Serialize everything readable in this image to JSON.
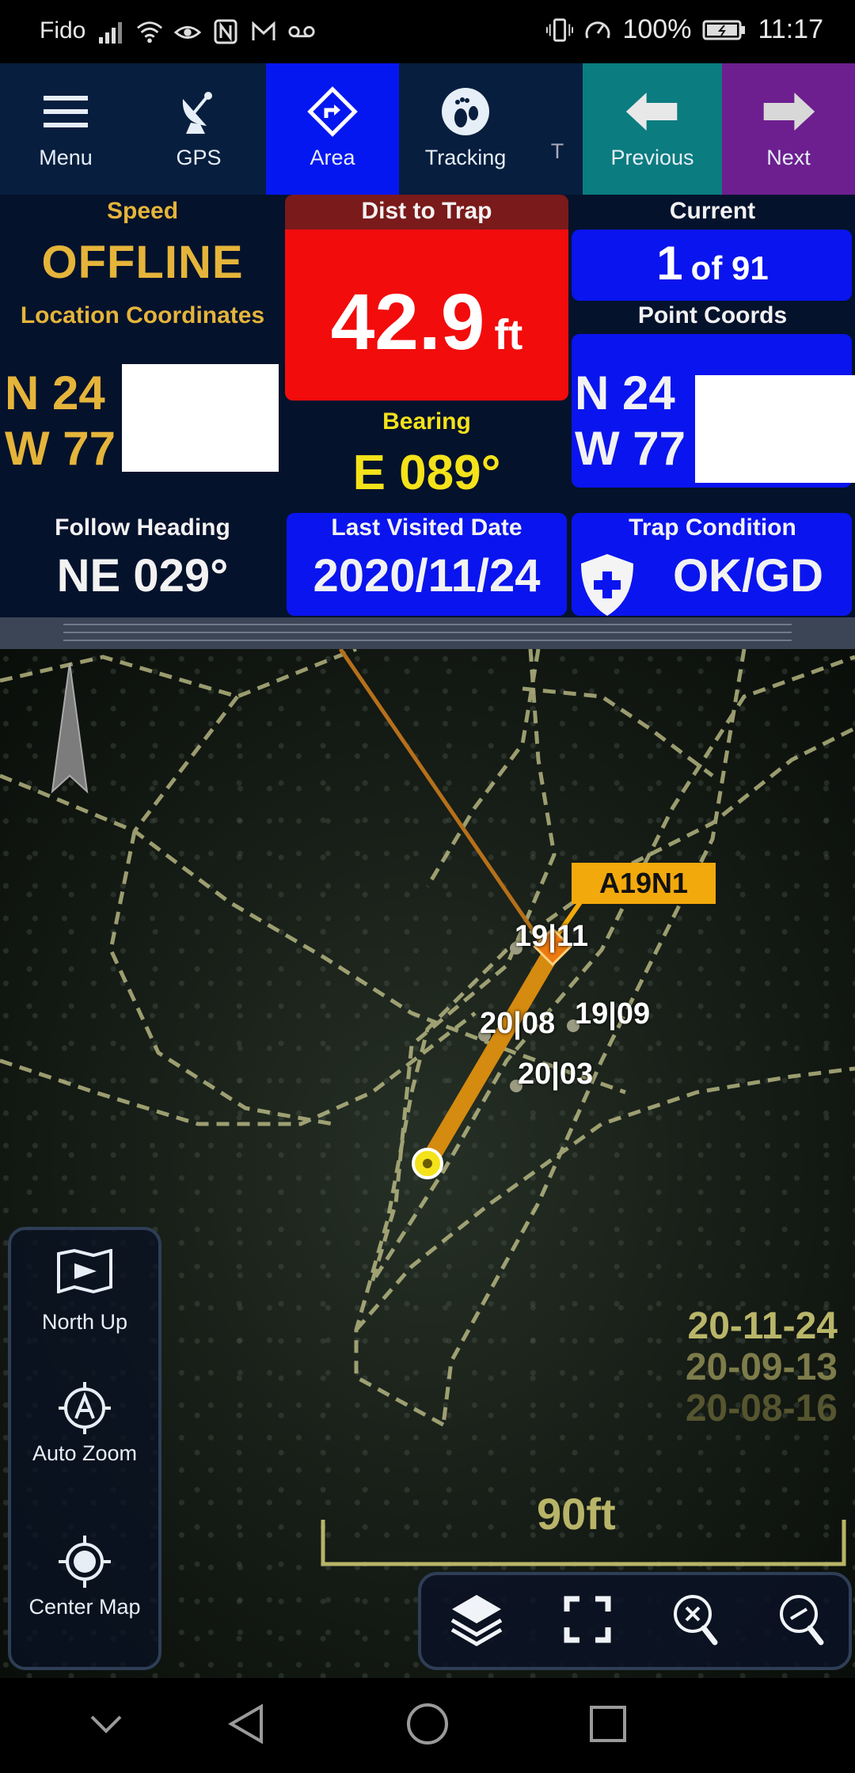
{
  "status_bar": {
    "carrier": "Fido",
    "battery": "100%",
    "time": "11:17"
  },
  "toolbar": {
    "menu": "Menu",
    "gps": "GPS",
    "area": "Area",
    "tracking": "Tracking",
    "partial": "T",
    "previous": "Previous",
    "next": "Next"
  },
  "data": {
    "speed_label": "Speed",
    "speed_value": "OFFLINE",
    "location_label": "Location Coordinates",
    "loc_lat": "N 24",
    "loc_lon": "W 77",
    "dist_label": "Dist to Trap",
    "dist_value": "42.9",
    "dist_unit": "ft",
    "bearing_label": "Bearing",
    "bearing_value": "E 089°",
    "current_label": "Current",
    "current_index": "1",
    "current_total": "of 91",
    "point_label": "Point Coords",
    "pt_lat": "N 24",
    "pt_lon": "W 77",
    "heading_label": "Follow Heading",
    "heading_value": "NE 029°",
    "visited_label": "Last Visited Date",
    "visited_value": "2020/11/24",
    "condition_label": "Trap Condition",
    "condition_value": "OK/GD"
  },
  "map": {
    "trap_callout": "A19N1",
    "labels": [
      "19|11",
      "20|08",
      "19|09",
      "20|03"
    ],
    "dates": [
      "20-11-24",
      "20-09-13",
      "20-08-16"
    ],
    "date_colors": [
      "#b9b66a",
      "#7d7c4a",
      "#55552f"
    ],
    "scale": "90ft",
    "side": {
      "north_up": "North Up",
      "auto_zoom": "Auto Zoom",
      "center_map": "Center Map"
    }
  },
  "colors": {
    "toolbar_bg": "#071e3e",
    "area_active": "#0517f0",
    "previous": "#0b7c80",
    "next": "#6d1f8f",
    "dist_panel": "#f20c0c",
    "blue_panel": "#0a14ee",
    "gold_text": "#e5b43a",
    "yellow_text": "#f4e21a",
    "track_orange": "#d58a10"
  }
}
